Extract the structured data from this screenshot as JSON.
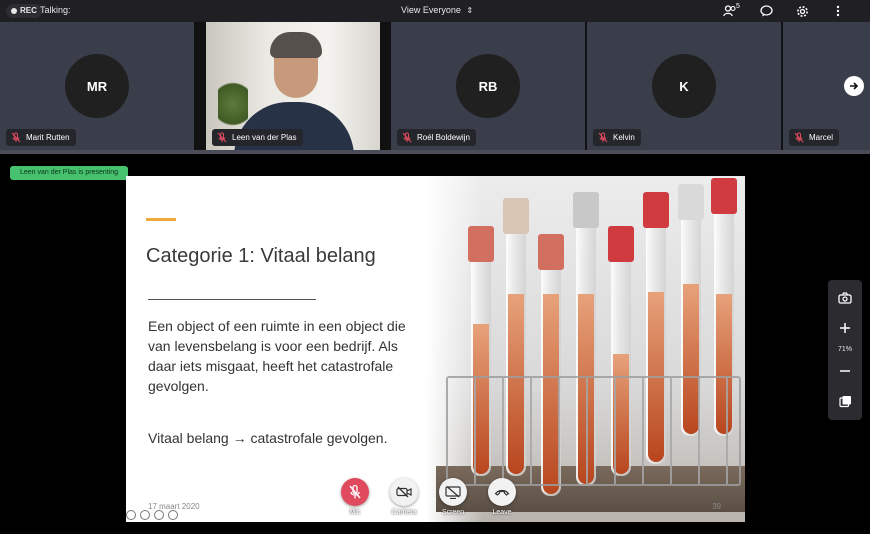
{
  "topbar": {
    "rec_label": "REC",
    "talking_label": "Talking:",
    "view_label": "View Everyone",
    "participants_count": "5"
  },
  "participants": [
    {
      "initials": "MR",
      "name": "Marit Rutten"
    },
    {
      "initials": "",
      "name": "Leen van der Plas"
    },
    {
      "initials": "RB",
      "name": "Roél Boldewijn"
    },
    {
      "initials": "K",
      "name": "Kelvin"
    },
    {
      "initials": "",
      "name": "Marcel"
    }
  ],
  "presenting_label": "Leen van der Plas is presenting",
  "slide": {
    "title": "Categorie 1: Vitaal belang",
    "body": "Een object of een ruimte in een object die van levensbelang is voor een bedrijf. Als daar iets misgaat, heeft het catastrofale gevolgen.",
    "summary_left": "Vitaal belang",
    "summary_arrow": "→",
    "summary_right": "catastrofale gevolgen.",
    "date": "17 maart 2020",
    "page": "39",
    "accent_color": "#f2a93b"
  },
  "controls": {
    "mic_label": "Mic",
    "camera_label": "Camera",
    "screen_label": "Screen",
    "leave_label": "Leave"
  },
  "side_panel": {
    "zoom_level": "71%"
  },
  "colors": {
    "mic_red": "#e04a5f",
    "presenting_green": "#46c16d"
  }
}
